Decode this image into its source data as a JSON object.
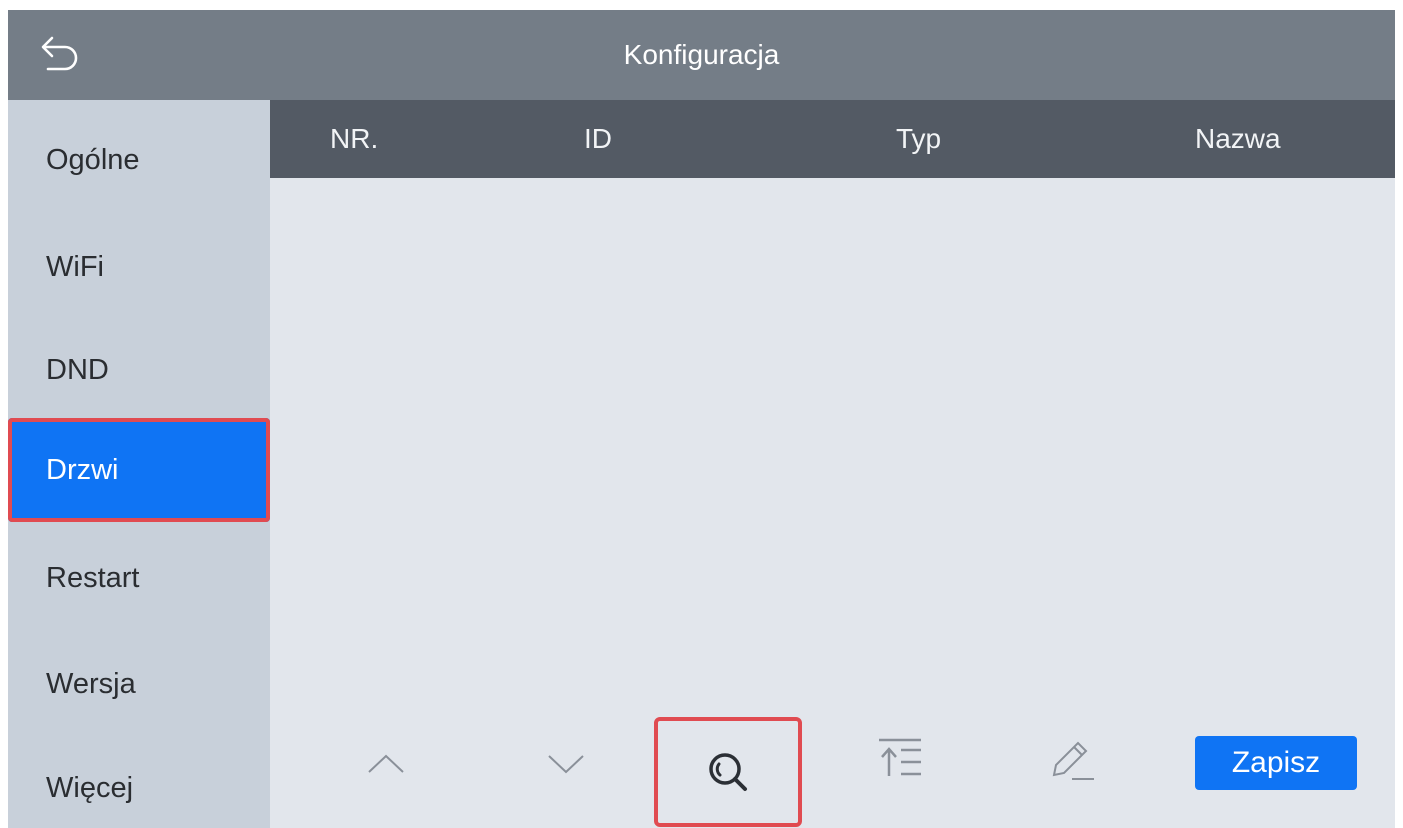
{
  "header": {
    "title": "Konfiguracja",
    "back_icon": "back-arrow-icon"
  },
  "sidebar": {
    "items": [
      {
        "label": "Ogólne"
      },
      {
        "label": "WiFi"
      },
      {
        "label": "DND"
      },
      {
        "label": "Drzwi",
        "active": true
      },
      {
        "label": "Restart"
      },
      {
        "label": "Wersja"
      },
      {
        "label": "Więcej"
      }
    ]
  },
  "table": {
    "columns": [
      "NR.",
      "ID",
      "Typ",
      "Nazwa"
    ],
    "rows": []
  },
  "toolbar": {
    "up_icon": "chevron-up-icon",
    "down_icon": "chevron-down-icon",
    "search_icon": "search-icon",
    "move_top_icon": "move-to-top-icon",
    "edit_icon": "pencil-icon",
    "save_label": "Zapisz"
  },
  "colors": {
    "topbar": "#747d87",
    "sidebar": "#c8d0da",
    "table_header": "#535a64",
    "content": "#e2e6ec",
    "accent": "#0f74f4",
    "highlight_border": "#e04b51"
  }
}
